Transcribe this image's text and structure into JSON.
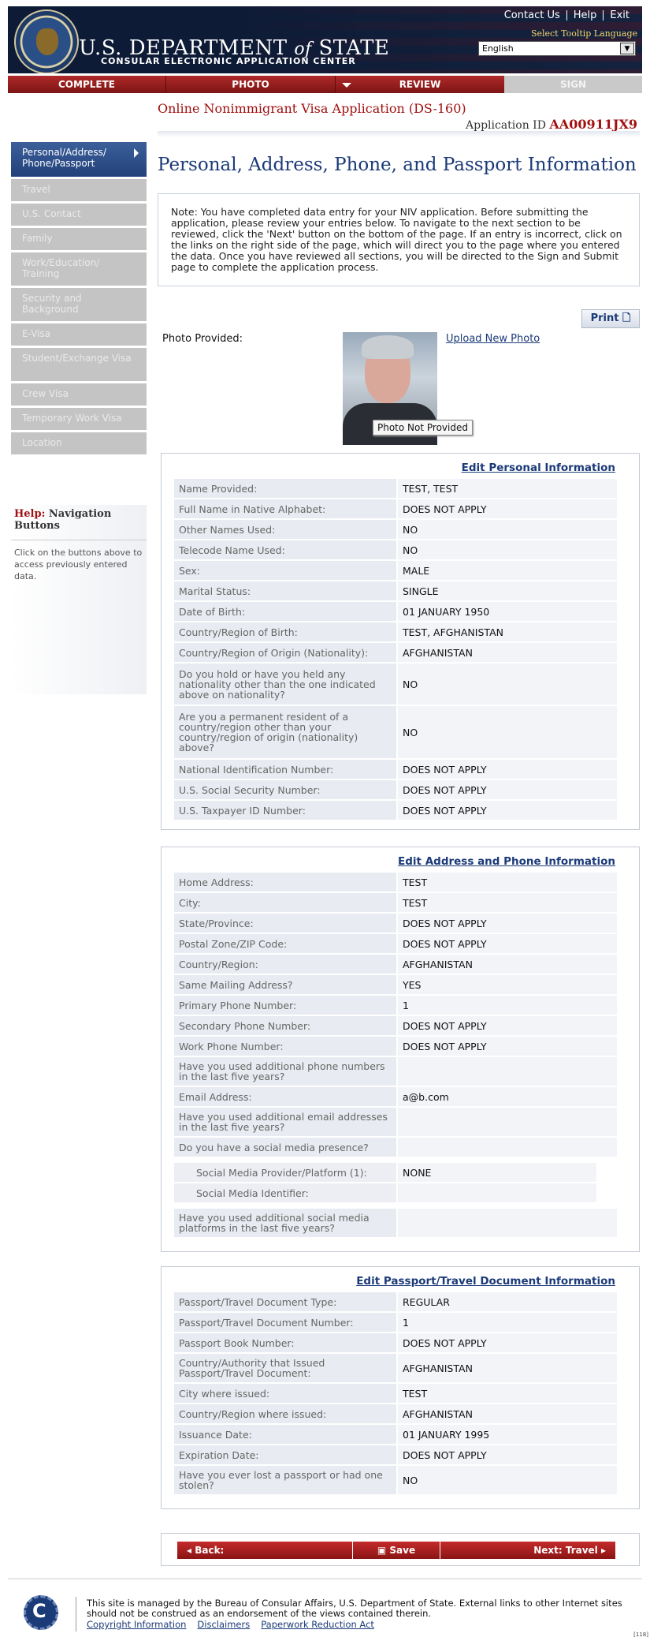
{
  "header": {
    "brand": "U.S. DEPARTMENT",
    "brand_of": "of",
    "brand_state": "STATE",
    "subtitle": "CONSULAR ELECTRONIC APPLICATION CENTER",
    "menu": [
      "Contact Us",
      "Help",
      "Exit"
    ],
    "tooltip_label": "Select Tooltip Language",
    "language": "English"
  },
  "progress": {
    "steps": [
      "COMPLETE",
      "PHOTO",
      "REVIEW",
      "SIGN"
    ]
  },
  "app": {
    "title": "Online Nonimmigrant Visa Application (DS-160)",
    "id_label": "Application ID",
    "id": "AA00911JX9",
    "page_title": "Personal, Address, Phone, and Passport Information"
  },
  "sidebar": {
    "items": [
      "Personal/Address/ Phone/Passport",
      "Travel",
      "U.S. Contact",
      "Family",
      "Work/Education/ Training",
      "Security and Background",
      "E-Visa",
      "Student/Exchange Visa",
      "Crew Visa",
      "Temporary Work Visa",
      "Location"
    ]
  },
  "help": {
    "title_prefix": "Help:",
    "title": "Navigation Buttons",
    "text": "Click on the buttons above to access previously entered data."
  },
  "note": "Note: You have completed data entry for your NIV application. Before submitting the application, please review your entries below. To navigate to the next section to be reviewed, click the 'Next' button on the bottom of the page. If an entry is incorrect, click on the links on the right side of the page, which will direct you to the page where you entered the data. Once you have reviewed all sections, you will be directed to the Sign and Submit page to complete the application process.",
  "print": "Print",
  "photo": {
    "label": "Photo Provided:",
    "upload": "Upload New Photo",
    "tooltip": "Photo Not Provided"
  },
  "personal": {
    "edit": "Edit Personal Information",
    "rows": [
      [
        "Name Provided:",
        "TEST, TEST"
      ],
      [
        "Full Name in Native Alphabet:",
        "DOES NOT APPLY"
      ],
      [
        " Other Names Used:",
        "NO"
      ],
      [
        "Telecode Name Used:",
        "NO"
      ],
      [
        "Sex:",
        "MALE"
      ],
      [
        "Marital Status:",
        "SINGLE"
      ],
      [
        "Date of Birth:",
        "01 JANUARY 1950"
      ],
      [
        "Country/Region of Birth:",
        "TEST, AFGHANISTAN"
      ],
      [
        "Country/Region of Origin (Nationality):",
        "AFGHANISTAN"
      ],
      [
        "Do you hold or have you held any nationality other than the one indicated above on nationality?",
        "NO"
      ],
      [
        "Are you a permanent resident of a country/region other than your country/region of origin (nationality) above?",
        "NO"
      ],
      [
        "National Identification Number:",
        "DOES NOT APPLY"
      ],
      [
        "U.S. Social Security Number:",
        "DOES NOT APPLY"
      ],
      [
        "U.S. Taxpayer ID Number:",
        "DOES NOT APPLY"
      ]
    ]
  },
  "address": {
    "edit": "Edit Address and Phone Information",
    "rows": [
      [
        "Home Address:",
        "TEST"
      ],
      [
        " City:",
        "TEST"
      ],
      [
        " State/Province:",
        "DOES NOT APPLY"
      ],
      [
        " Postal Zone/ZIP Code:",
        "DOES NOT APPLY"
      ],
      [
        " Country/Region:",
        "AFGHANISTAN"
      ],
      [
        "Same Mailing Address?",
        "YES"
      ],
      [
        "Primary Phone Number:",
        "1"
      ],
      [
        "Secondary Phone Number:",
        "DOES NOT APPLY"
      ],
      [
        "Work Phone Number:",
        "DOES NOT APPLY"
      ],
      [
        "Have you used additional phone numbers in the last five years?",
        ""
      ],
      [
        "Email Address:",
        "a@b.com"
      ],
      [
        "Have you used additional email addresses in the last five years?",
        ""
      ],
      [
        "Do you have a social media presence?",
        ""
      ]
    ],
    "social": [
      [
        "Social Media Provider/Platform (1):",
        "NONE"
      ],
      [
        "Social Media Identifier:",
        ""
      ]
    ],
    "last": [
      "Have you used additional social media platforms in the last five years?",
      ""
    ]
  },
  "passport": {
    "edit": "Edit Passport/Travel Document Information",
    "rows": [
      [
        "Passport/Travel Document Type:",
        "REGULAR"
      ],
      [
        "Passport/Travel Document Number:",
        "1"
      ],
      [
        "Passport Book Number:",
        "DOES NOT APPLY"
      ],
      [
        "Country/Authority that Issued Passport/Travel Document:",
        "AFGHANISTAN"
      ],
      [
        "City where issued:",
        "TEST"
      ],
      [
        "Country/Region where issued:",
        "AFGHANISTAN"
      ],
      [
        "Issuance Date:",
        "01 JANUARY 1995"
      ],
      [
        "Expiration Date:",
        "DOES NOT APPLY"
      ],
      [
        "Have you ever lost a passport or had one stolen?",
        "NO"
      ]
    ]
  },
  "buttons": {
    "back": "Back:",
    "save": "Save",
    "next": "Next: Travel"
  },
  "footer": {
    "text": "This site is managed by the Bureau of Consular Affairs, U.S. Department of State. External links to other Internet sites should not be construed as an endorsement of the views contained therein.",
    "links": [
      "Copyright Information",
      "Disclaimers",
      "Paperwork Reduction Act"
    ],
    "code": "[118]"
  }
}
